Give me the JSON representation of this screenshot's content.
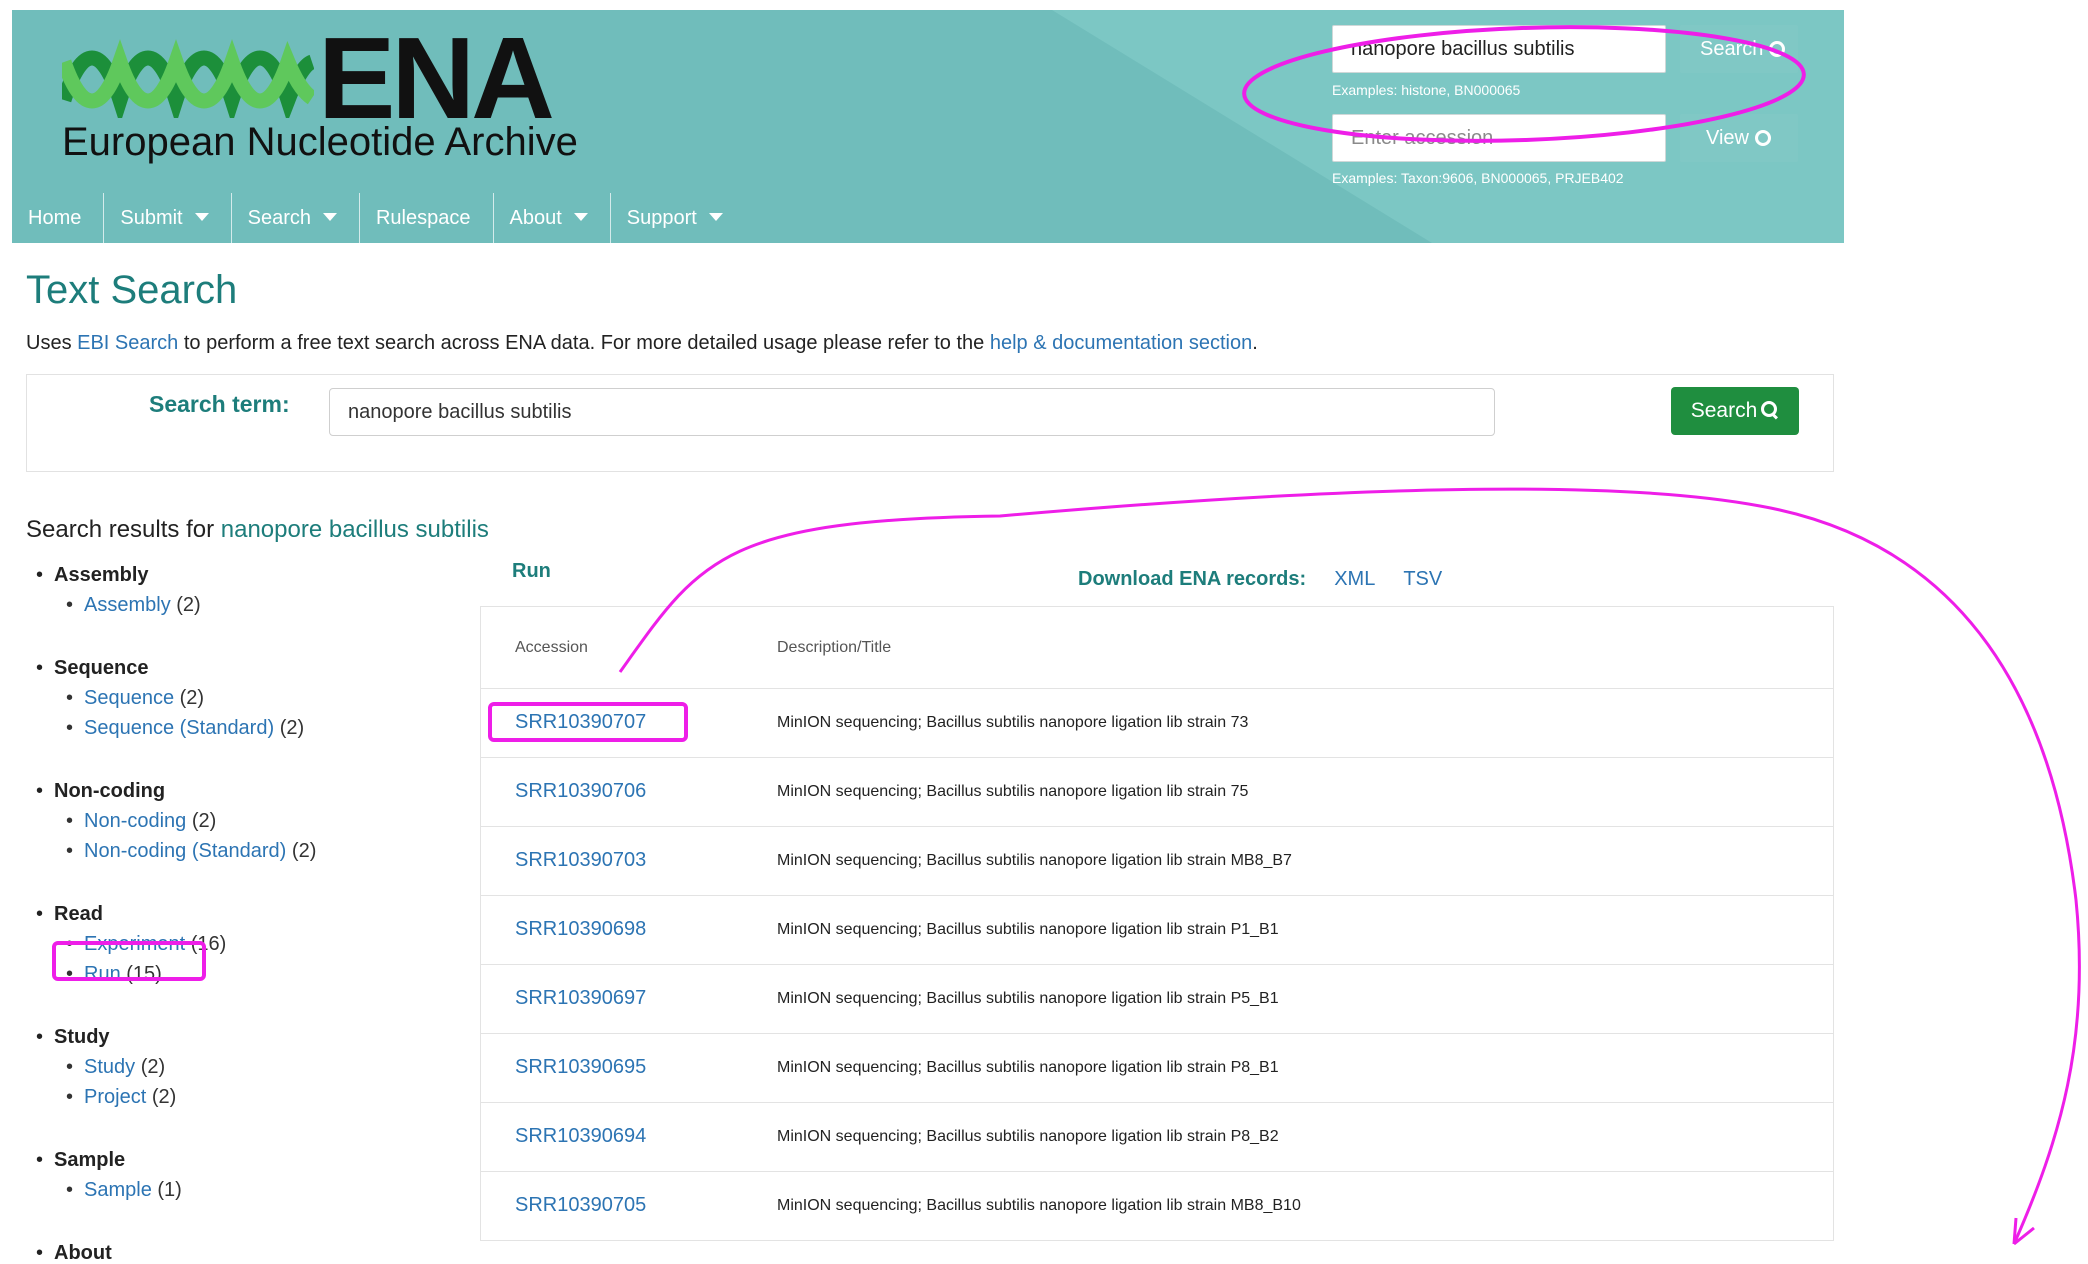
{
  "header": {
    "logo_mark": "ENA",
    "logo_name": "European Nucleotide Archive",
    "search_value": "nanopore bacillus subtilis",
    "search_button": "Search",
    "search_hint": "Examples: histone, BN000065",
    "accession_placeholder": "Enter accession",
    "view_button": "View",
    "accession_hint": "Examples: Taxon:9606, BN000065, PRJEB402"
  },
  "nav": {
    "items": [
      {
        "label": "Home",
        "dropdown": false
      },
      {
        "label": "Submit",
        "dropdown": true
      },
      {
        "label": "Search",
        "dropdown": true
      },
      {
        "label": "Rulespace",
        "dropdown": false
      },
      {
        "label": "About",
        "dropdown": true
      },
      {
        "label": "Support",
        "dropdown": true
      }
    ]
  },
  "main": {
    "title": "Text Search",
    "intro_prefix": "Uses ",
    "intro_link1": "EBI Search",
    "intro_middle": " to perform a free text search across ENA data. For more detailed usage please refer to the ",
    "intro_link2": "help & documentation section",
    "intro_suffix": ".",
    "search_label": "Search term:",
    "search_value": "nanopore bacillus subtilis",
    "search_button": "Search",
    "results_prefix": "Search results for ",
    "results_term": "nanopore bacillus subtilis"
  },
  "facets": [
    {
      "title": "Assembly",
      "items": [
        {
          "label": "Assembly",
          "count": "(2)"
        }
      ]
    },
    {
      "title": "Sequence",
      "items": [
        {
          "label": "Sequence",
          "count": "(2)"
        },
        {
          "label": "Sequence (Standard)",
          "count": "(2)"
        }
      ]
    },
    {
      "title": "Non-coding",
      "items": [
        {
          "label": "Non-coding",
          "count": "(2)"
        },
        {
          "label": "Non-coding (Standard)",
          "count": "(2)"
        }
      ]
    },
    {
      "title": "Read",
      "items": [
        {
          "label": "Experiment",
          "count": "(16)"
        },
        {
          "label": "Run",
          "count": "(15)"
        }
      ]
    },
    {
      "title": "Study",
      "items": [
        {
          "label": "Study",
          "count": "(2)"
        },
        {
          "label": "Project",
          "count": "(2)"
        }
      ]
    },
    {
      "title": "Sample",
      "items": [
        {
          "label": "Sample",
          "count": "(1)"
        }
      ]
    },
    {
      "title": "About",
      "items": []
    }
  ],
  "results": {
    "section_label": "Run",
    "download_label": "Download ENA records:",
    "download_formats": [
      "XML",
      "TSV"
    ],
    "columns": [
      "Accession",
      "Description/Title"
    ],
    "rows": [
      {
        "accession": "SRR10390707",
        "description": "MinION sequencing; Bacillus subtilis nanopore ligation lib strain 73"
      },
      {
        "accession": "SRR10390706",
        "description": "MinION sequencing; Bacillus subtilis nanopore ligation lib strain 75"
      },
      {
        "accession": "SRR10390703",
        "description": "MinION sequencing; Bacillus subtilis nanopore ligation lib strain MB8_B7"
      },
      {
        "accession": "SRR10390698",
        "description": "MinION sequencing; Bacillus subtilis nanopore ligation lib strain P1_B1"
      },
      {
        "accession": "SRR10390697",
        "description": "MinION sequencing; Bacillus subtilis nanopore ligation lib strain P5_B1"
      },
      {
        "accession": "SRR10390695",
        "description": "MinION sequencing; Bacillus subtilis nanopore ligation lib strain P8_B1"
      },
      {
        "accession": "SRR10390694",
        "description": "MinION sequencing; Bacillus subtilis nanopore ligation lib strain P8_B2"
      },
      {
        "accession": "SRR10390705",
        "description": "MinION sequencing; Bacillus subtilis nanopore ligation lib strain MB8_B10"
      }
    ]
  },
  "colors": {
    "header_bg": "#70bdbb",
    "accent_teal": "#1d7d7b",
    "link_blue": "#2c74b3",
    "search_green": "#1f8e3f",
    "annotation_magenta": "#ee1ee8"
  }
}
